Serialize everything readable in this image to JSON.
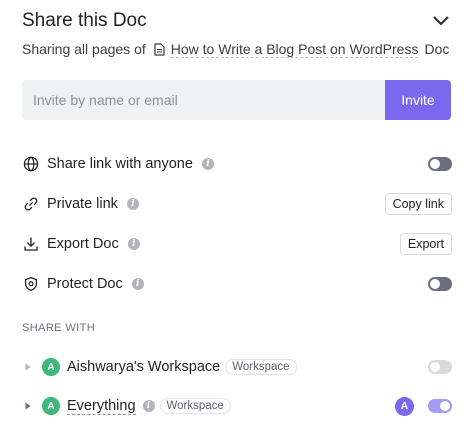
{
  "header": {
    "title": "Share this Doc"
  },
  "subtitle": {
    "prefix": "Sharing all pages of",
    "doc_name": "How to Write a Blog Post on WordPress",
    "suffix": "Doc"
  },
  "invite": {
    "placeholder": "Invite by name or email",
    "button_label": "Invite"
  },
  "options": {
    "share_link": {
      "label": "Share link with anyone",
      "enabled": false
    },
    "private_link": {
      "label": "Private link",
      "button_label": "Copy link"
    },
    "export_doc": {
      "label": "Export Doc",
      "button_label": "Export"
    },
    "protect_doc": {
      "label": "Protect Doc",
      "enabled": false
    }
  },
  "share_with": {
    "heading": "SHARE WITH",
    "items": [
      {
        "avatar": "A",
        "name": "Aishwarya's Workspace",
        "tag": "Workspace",
        "enabled": false
      },
      {
        "avatar": "A",
        "name": "Everything",
        "tag": "Workspace",
        "member_avatar": "A",
        "enabled": true
      }
    ]
  },
  "colors": {
    "accent": "#7b68ee",
    "avatar_green": "#3fb67a",
    "toggle_off": "#6b6f7a",
    "input_bg": "#f0f1f3"
  }
}
